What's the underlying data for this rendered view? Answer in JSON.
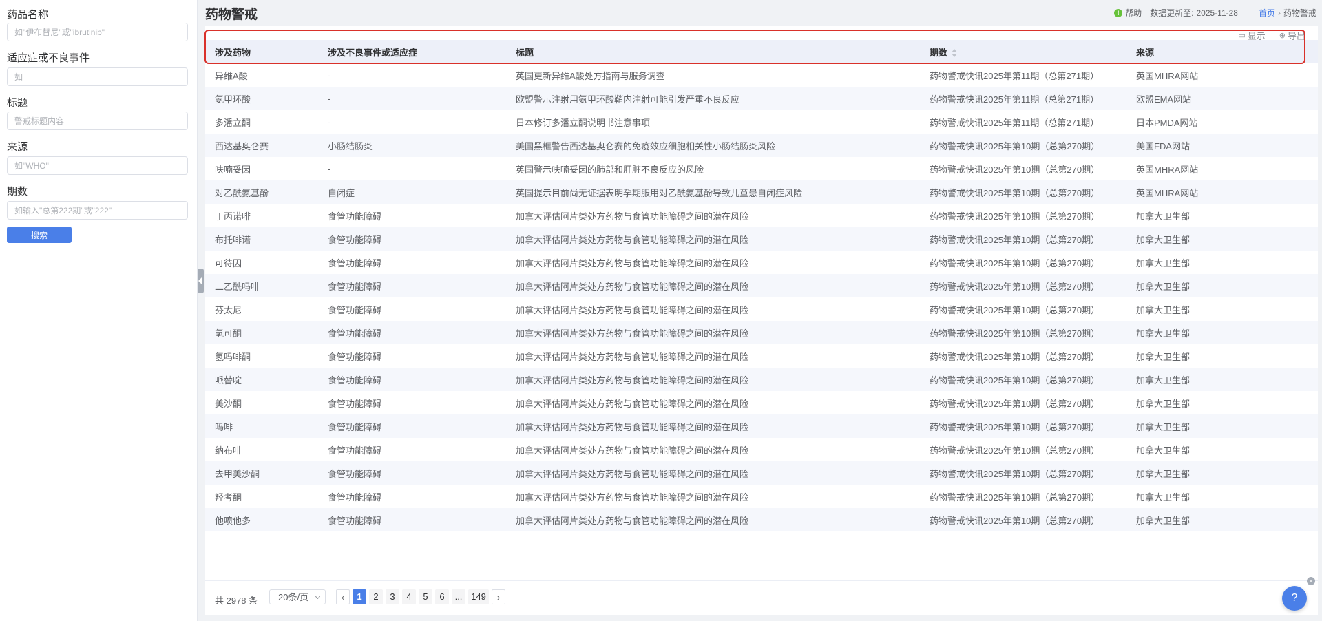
{
  "sidebar": {
    "fields": [
      {
        "label": "药品名称",
        "placeholder": "如\"伊布替尼\"或\"ibrutinib\"",
        "value": ""
      },
      {
        "label": "适应症或不良事件",
        "placeholder": "如",
        "value": ""
      },
      {
        "label": "标题",
        "placeholder": "警戒标题内容",
        "value": ""
      },
      {
        "label": "来源",
        "placeholder": "如\"WHO\"",
        "value": ""
      },
      {
        "label": "期数",
        "placeholder": "如输入\"总第222期\"或\"222\"",
        "value": ""
      }
    ],
    "search_label": "搜索"
  },
  "header": {
    "title": "药物警戒",
    "help_icon": "!",
    "help_label": "帮助",
    "update_label": "数据更新至:",
    "update_date": "2025-11-28",
    "breadcrumb": {
      "home": "首页",
      "separator": "›",
      "current": "药物警戒"
    }
  },
  "toolbar": {
    "display_icon": "▭",
    "display_label": "显示",
    "export_icon": "⊕",
    "export_label": "导出"
  },
  "table": {
    "columns": [
      "涉及药物",
      "涉及不良事件或适应症",
      "标题",
      "期数",
      "来源"
    ],
    "rows": [
      [
        "异维A酸",
        "-",
        "英国更新异维A酸处方指南与服务调查",
        "药物警戒快讯2025年第11期（总第271期）",
        "英国MHRA网站"
      ],
      [
        "氨甲环酸",
        "-",
        "欧盟警示注射用氨甲环酸鞘内注射可能引发严重不良反应",
        "药物警戒快讯2025年第11期（总第271期）",
        "欧盟EMA网站"
      ],
      [
        "多潘立酮",
        "-",
        "日本修订多潘立酮说明书注意事项",
        "药物警戒快讯2025年第11期（总第271期）",
        "日本PMDA网站"
      ],
      [
        "西达基奥仑赛",
        "小肠结肠炎",
        "美国黑框警告西达基奥仑赛的免疫效应细胞相关性小肠结肠炎风险",
        "药物警戒快讯2025年第10期（总第270期）",
        "美国FDA网站"
      ],
      [
        "呋喃妥因",
        "-",
        "英国警示呋喃妥因的肺部和肝脏不良反应的风险",
        "药物警戒快讯2025年第10期（总第270期）",
        "英国MHRA网站"
      ],
      [
        "对乙酰氨基酚",
        "自闭症",
        "英国提示目前尚无证据表明孕期服用对乙酰氨基酚导致儿童患自闭症风险",
        "药物警戒快讯2025年第10期（总第270期）",
        "英国MHRA网站"
      ],
      [
        "丁丙诺啡",
        "食管功能障碍",
        "加拿大评估阿片类处方药物与食管功能障碍之间的潜在风险",
        "药物警戒快讯2025年第10期（总第270期）",
        "加拿大卫生部"
      ],
      [
        "布托啡诺",
        "食管功能障碍",
        "加拿大评估阿片类处方药物与食管功能障碍之间的潜在风险",
        "药物警戒快讯2025年第10期（总第270期）",
        "加拿大卫生部"
      ],
      [
        "可待因",
        "食管功能障碍",
        "加拿大评估阿片类处方药物与食管功能障碍之间的潜在风险",
        "药物警戒快讯2025年第10期（总第270期）",
        "加拿大卫生部"
      ],
      [
        "二乙酰吗啡",
        "食管功能障碍",
        "加拿大评估阿片类处方药物与食管功能障碍之间的潜在风险",
        "药物警戒快讯2025年第10期（总第270期）",
        "加拿大卫生部"
      ],
      [
        "芬太尼",
        "食管功能障碍",
        "加拿大评估阿片类处方药物与食管功能障碍之间的潜在风险",
        "药物警戒快讯2025年第10期（总第270期）",
        "加拿大卫生部"
      ],
      [
        "氢可酮",
        "食管功能障碍",
        "加拿大评估阿片类处方药物与食管功能障碍之间的潜在风险",
        "药物警戒快讯2025年第10期（总第270期）",
        "加拿大卫生部"
      ],
      [
        "氢吗啡酮",
        "食管功能障碍",
        "加拿大评估阿片类处方药物与食管功能障碍之间的潜在风险",
        "药物警戒快讯2025年第10期（总第270期）",
        "加拿大卫生部"
      ],
      [
        "哌替啶",
        "食管功能障碍",
        "加拿大评估阿片类处方药物与食管功能障碍之间的潜在风险",
        "药物警戒快讯2025年第10期（总第270期）",
        "加拿大卫生部"
      ],
      [
        "美沙酮",
        "食管功能障碍",
        "加拿大评估阿片类处方药物与食管功能障碍之间的潜在风险",
        "药物警戒快讯2025年第10期（总第270期）",
        "加拿大卫生部"
      ],
      [
        "吗啡",
        "食管功能障碍",
        "加拿大评估阿片类处方药物与食管功能障碍之间的潜在风险",
        "药物警戒快讯2025年第10期（总第270期）",
        "加拿大卫生部"
      ],
      [
        "纳布啡",
        "食管功能障碍",
        "加拿大评估阿片类处方药物与食管功能障碍之间的潜在风险",
        "药物警戒快讯2025年第10期（总第270期）",
        "加拿大卫生部"
      ],
      [
        "去甲美沙酮",
        "食管功能障碍",
        "加拿大评估阿片类处方药物与食管功能障碍之间的潜在风险",
        "药物警戒快讯2025年第10期（总第270期）",
        "加拿大卫生部"
      ],
      [
        "羟考酮",
        "食管功能障碍",
        "加拿大评估阿片类处方药物与食管功能障碍之间的潜在风险",
        "药物警戒快讯2025年第10期（总第270期）",
        "加拿大卫生部"
      ],
      [
        "他喷他多",
        "食管功能障碍",
        "加拿大评估阿片类处方药物与食管功能障碍之间的潜在风险",
        "药物警戒快讯2025年第10期（总第270期）",
        "加拿大卫生部"
      ]
    ]
  },
  "pagination": {
    "total_text": "共 2978 条",
    "page_size": "20条/页",
    "prev": "‹",
    "next": "›",
    "pages": [
      "1",
      "2",
      "3",
      "4",
      "5",
      "6",
      "...",
      "149"
    ],
    "current": "1"
  },
  "float": {
    "help_icon": "?",
    "close_icon": "×"
  },
  "colors": {
    "accent": "#4a7fe8",
    "highlight": "#d9312a",
    "header_bg": "#edf0f9",
    "stripe": "#f5f7fc"
  }
}
